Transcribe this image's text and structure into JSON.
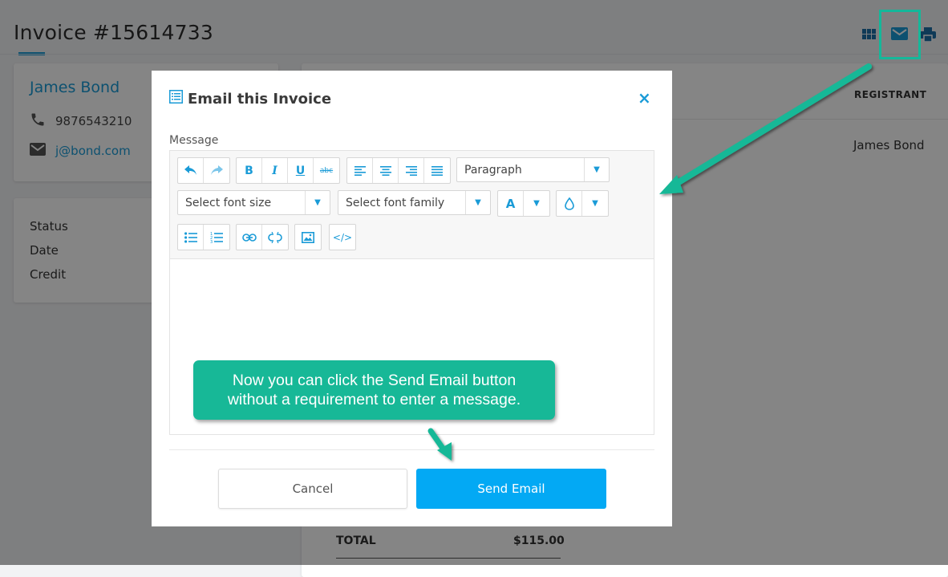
{
  "page": {
    "title": "Invoice #15614733",
    "customer": {
      "name": "James Bond",
      "phone": "9876543210",
      "email": "j@bond.com"
    },
    "meta_labels": [
      "Status",
      "Date",
      "Credit"
    ],
    "registrant": {
      "header": "REGISTRANT",
      "value": "James Bond"
    },
    "total": {
      "label": "TOTAL",
      "value": "$115.00"
    },
    "header_icons": [
      "grid-icon",
      "mail-icon",
      "print-icon"
    ]
  },
  "modal": {
    "title": "Email this Invoice",
    "close_label": "×",
    "message_label": "Message",
    "toolbar": {
      "block_format": "Paragraph",
      "font_size_placeholder": "Select font size",
      "font_family_placeholder": "Select font family"
    },
    "cancel_label": "Cancel",
    "send_label": "Send Email"
  },
  "callout": {
    "line1": "Now you can click the Send Email button",
    "line2": "without a requirement to enter a message."
  },
  "colors": {
    "accent": "#1a9bd7",
    "send_button": "#03a9f4",
    "callout": "#17b897"
  }
}
